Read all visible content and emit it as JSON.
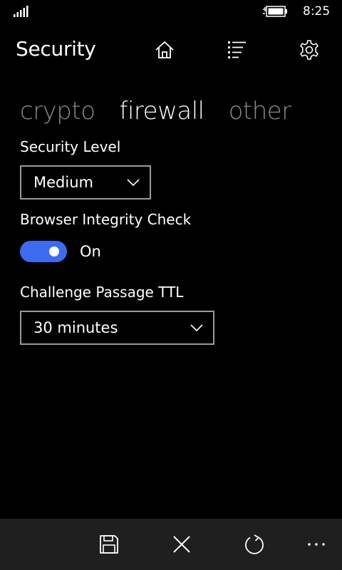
{
  "status_bar": {
    "time": "8:25",
    "signal_icon": "signal-strength-icon",
    "battery_icon": "battery-charging-icon"
  },
  "header": {
    "title": "Security",
    "icons": [
      "home-icon",
      "list-icon",
      "gear-icon"
    ]
  },
  "pivot": {
    "tabs": [
      {
        "label": "crypto",
        "active": false
      },
      {
        "label": "firewall",
        "active": true
      },
      {
        "label": "other",
        "active": false
      }
    ]
  },
  "settings": {
    "security_level": {
      "label": "Security Level",
      "value": "Medium"
    },
    "browser_integrity": {
      "label": "Browser Integrity Check",
      "state": "On",
      "enabled": true
    },
    "challenge_ttl": {
      "label": "Challenge Passage TTL",
      "value": "30 minutes"
    }
  },
  "app_bar": {
    "icons": [
      "save-icon",
      "close-icon",
      "refresh-icon",
      "more-icon"
    ]
  },
  "colors": {
    "accent": "#3d6bf0",
    "background": "#000000",
    "app_bar": "#1f1f1f",
    "inactive_tab": "#8a8a8a"
  }
}
